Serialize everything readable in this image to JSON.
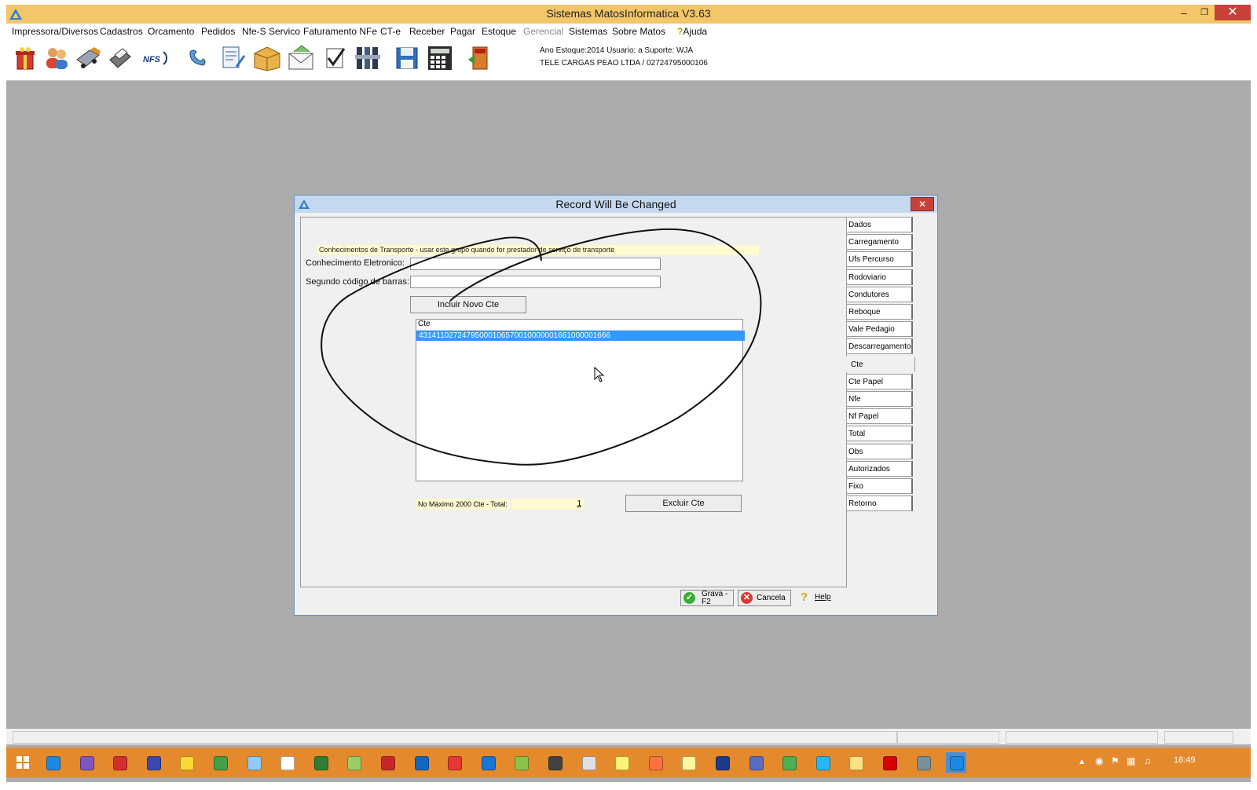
{
  "window": {
    "title": "Sistemas MatosInformatica V3.63",
    "controls": {
      "minimize": "–",
      "restore": "❐",
      "close": "✕"
    }
  },
  "menu": {
    "items": [
      {
        "label": "Impressora/Diversos",
        "enabled": true
      },
      {
        "label": "Cadastros",
        "enabled": true
      },
      {
        "label": "Orcamento",
        "enabled": true
      },
      {
        "label": "Pedidos",
        "enabled": true
      },
      {
        "label": "Nfe-S Servico",
        "enabled": true
      },
      {
        "label": "Faturamento NFe",
        "enabled": true
      },
      {
        "label": "CT-e",
        "enabled": true
      },
      {
        "label": "Receber",
        "enabled": true
      },
      {
        "label": "Pagar",
        "enabled": true
      },
      {
        "label": "Estoque",
        "enabled": true
      },
      {
        "label": "Gerencial",
        "enabled": false
      },
      {
        "label": "Sistemas",
        "enabled": true
      },
      {
        "label": "Sobre Matos",
        "enabled": true
      }
    ],
    "help_label": "Ajuda"
  },
  "toolbar": {
    "icons": [
      "gift-icon",
      "users-icon",
      "truck-icon",
      "printer-icon",
      "nfse-icon",
      "phone-icon",
      "document-edit-icon",
      "package-icon",
      "envelope-icon",
      "checklist-icon",
      "tools-icon",
      "floppy-disk-icon",
      "calculator-icon",
      "exit-door-icon"
    ],
    "nfse_text": "NFS",
    "info_line1": "Ano Estoque:2014 Usuario: a Suporte: WJA",
    "info_line2": "TELE CARGAS PEAO LTDA / 02724795000106"
  },
  "dialog": {
    "title": "Record Will Be Changed",
    "close_glyph": "✕",
    "notice": "Conhecimentos de Transporte - usar este grupo quando for prestador de serviço de transporte",
    "fields": {
      "conhecimento_label": "Conhecimento Eletronico:",
      "conhecimento_value": "",
      "barcode_label": "Segundo código de barras:",
      "barcode_value": ""
    },
    "include_button": "Incluir Novo Cte",
    "list": {
      "header": "Cte",
      "rows": [
        "43141102724795000106570010000001661000001666"
      ]
    },
    "limit_label": "No Máximo 2000 Cte - Total:",
    "total_value": "1",
    "delete_button": "Excluir Cte",
    "tabs": [
      {
        "label": "Dados",
        "active": false
      },
      {
        "label": "Carregamento",
        "active": false
      },
      {
        "label": "Ufs Percurso",
        "active": false
      },
      {
        "label": "Rodoviario",
        "active": false
      },
      {
        "label": "Condutores",
        "active": false
      },
      {
        "label": "Reboque",
        "active": false
      },
      {
        "label": "Vale Pedagio",
        "active": false
      },
      {
        "label": "Descarregamento",
        "active": false
      },
      {
        "label": "Cte",
        "active": true
      },
      {
        "label": "Cte Papel",
        "active": false
      },
      {
        "label": "Nfe",
        "active": false
      },
      {
        "label": "Nf Papel",
        "active": false
      },
      {
        "label": "Total",
        "active": false
      },
      {
        "label": "Obs",
        "active": false
      },
      {
        "label": "Autorizados",
        "active": false
      },
      {
        "label": "Fixo",
        "active": false
      },
      {
        "label": "Retorno",
        "active": false
      }
    ],
    "footer": {
      "save_label_line1": "Grava -",
      "save_label_line2": "F2",
      "cancel_label": "Cancela",
      "help_label": "Help"
    }
  },
  "taskbar": {
    "apps": [
      "internet-explorer-icon",
      "visual-studio-icon",
      "filezilla-icon",
      "remote-desktop-icon",
      "network-tool-icon",
      "folder-share-icon",
      "notepad-icon",
      "chrome-like-icon",
      "spreadsheet-icon",
      "android-icon",
      "acrobat-reader-icon",
      "ie-blue-icon",
      "opera-icon",
      "matos-app-icon",
      "notepad-plus-icon",
      "terminal-icon",
      "circle-app-icon",
      "web-app-icon",
      "firefox-icon",
      "web-app-2-icon",
      "db-tool-icon",
      "virtualbox-icon",
      "chrome-icon",
      "skype-icon",
      "file-explorer-icon",
      "pdf-icon",
      "sql-tool-icon",
      "matos-active-icon"
    ],
    "clock": "16:49"
  },
  "colors": {
    "title_bar": "#f3c669",
    "taskbar": "#e58a2c",
    "selection": "#3399ff",
    "highlight_field": "#fffad0",
    "dialog_title": "#c4d9ef",
    "close_button": "#c7413a"
  }
}
